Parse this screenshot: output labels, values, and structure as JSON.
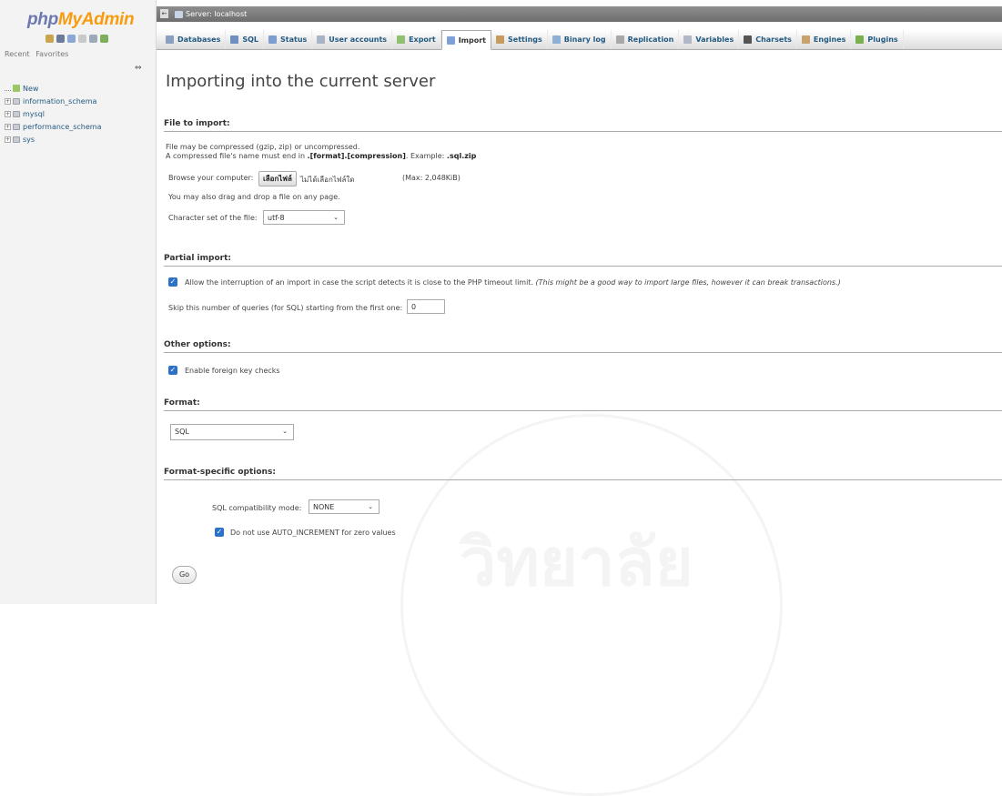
{
  "left": {
    "logo_php": "php",
    "logo_my": "MyAdmin",
    "recent": "Recent",
    "favorites": "Favorites",
    "collapse": "⇔",
    "tree": [
      {
        "label": "New",
        "kind": "new"
      },
      {
        "label": "information_schema",
        "kind": "db"
      },
      {
        "label": "mysql",
        "kind": "db"
      },
      {
        "label": "performance_schema",
        "kind": "db"
      },
      {
        "label": "sys",
        "kind": "db"
      }
    ]
  },
  "serverbar": {
    "crumb": "Server: localhost"
  },
  "tabs": [
    {
      "label": "Databases",
      "icon": "database-icon",
      "color": "#8aa0c2"
    },
    {
      "label": "SQL",
      "icon": "sql-icon",
      "color": "#6f8fbf"
    },
    {
      "label": "Status",
      "icon": "status-icon",
      "color": "#7d9fd0"
    },
    {
      "label": "User accounts",
      "icon": "users-icon",
      "color": "#a7b3c6"
    },
    {
      "label": "Export",
      "icon": "export-icon",
      "color": "#8fbf6f"
    },
    {
      "label": "Import",
      "icon": "import-icon",
      "color": "#7fa0d8",
      "active": true
    },
    {
      "label": "Settings",
      "icon": "settings-icon",
      "color": "#c79b5c"
    },
    {
      "label": "Binary log",
      "icon": "binary-log-icon",
      "color": "#8fb0d6"
    },
    {
      "label": "Replication",
      "icon": "replication-icon",
      "color": "#a8a8a8"
    },
    {
      "label": "Variables",
      "icon": "variables-icon",
      "color": "#b0b8c6"
    },
    {
      "label": "Charsets",
      "icon": "charsets-icon",
      "color": "#555555"
    },
    {
      "label": "Engines",
      "icon": "engines-icon",
      "color": "#c7a26a"
    },
    {
      "label": "Plugins",
      "icon": "plugins-icon",
      "color": "#7ab04e"
    }
  ],
  "main": {
    "title": "Importing into the current server",
    "file_section": {
      "heading": "File to import:",
      "line1": "File may be compressed (gzip, zip) or uncompressed.",
      "line2_pre": "A compressed file's name must end in ",
      "line2_format": ".[format].[compression]",
      "line2_example_label": ". Example: ",
      "line2_example": ".sql.zip",
      "browse_label": "Browse your computer:",
      "choose_button": "เลือกไฟล์",
      "no_file": "ไม่ได้เลือกไฟล์ใด",
      "max_size": "(Max: 2,048KiB)",
      "drag_note": "You may also drag and drop a file on any page.",
      "charset_label": "Character set of the file:",
      "charset_value": "utf-8"
    },
    "partial_section": {
      "heading": "Partial import:",
      "allow_interrupt": "Allow the interruption of an import in case the script detects it is close to the PHP timeout limit.",
      "allow_interrupt_note": "(This might be a good way to import large files, however it can break transactions.)",
      "skip_label": "Skip this number of queries (for SQL) starting from the first one:",
      "skip_value": "0"
    },
    "other_section": {
      "heading": "Other options:",
      "foreign_key": "Enable foreign key checks"
    },
    "format_section": {
      "heading": "Format:",
      "format_value": "SQL"
    },
    "format_specific_section": {
      "heading": "Format-specific options:",
      "compat_label": "SQL compatibility mode:",
      "compat_value": "NONE",
      "auto_increment": "Do not use AUTO_INCREMENT for zero values"
    },
    "go_button": "Go"
  }
}
